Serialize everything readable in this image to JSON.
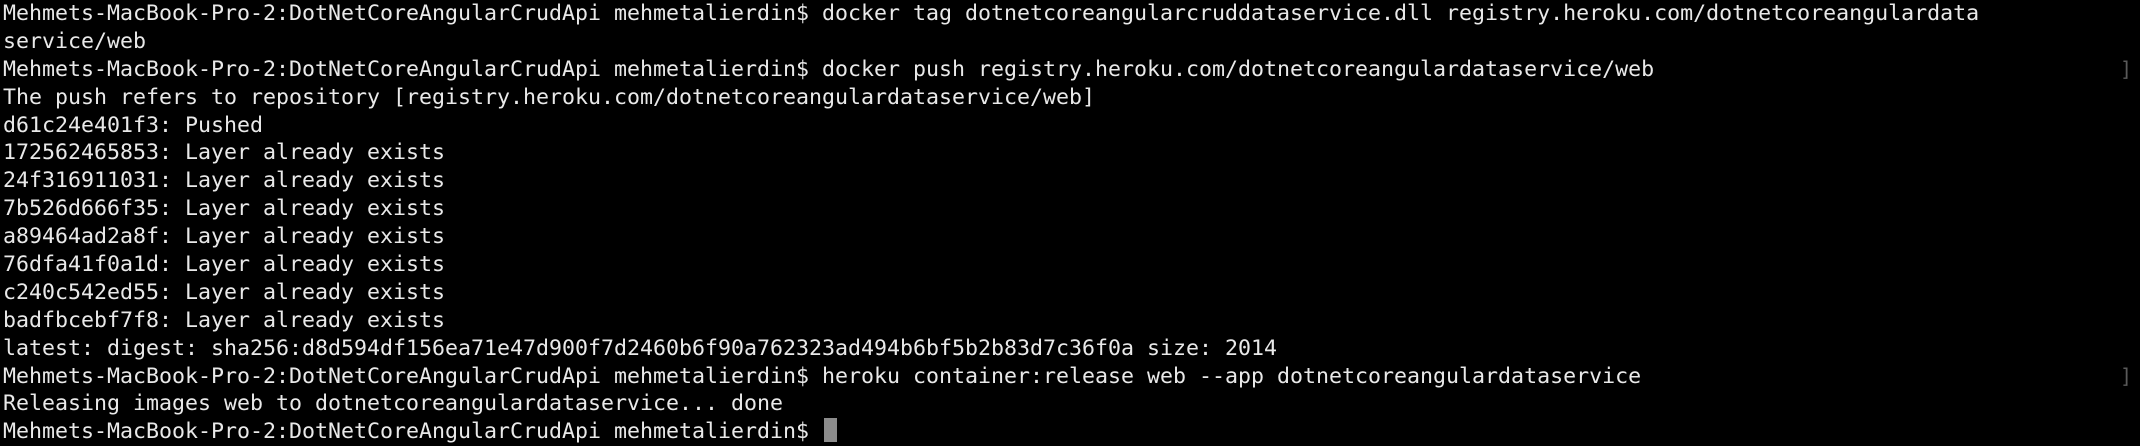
{
  "terminal": {
    "lines": [
      "Mehmets-MacBook-Pro-2:DotNetCoreAngularCrudApi mehmetalierdin$ docker tag dotnetcoreangularcruddataservice.dll registry.heroku.com/dotnetcoreangulardata",
      "service/web",
      "Mehmets-MacBook-Pro-2:DotNetCoreAngularCrudApi mehmetalierdin$ docker push registry.heroku.com/dotnetcoreangulardataservice/web",
      "The push refers to repository [registry.heroku.com/dotnetcoreangulardataservice/web]",
      "d61c24e401f3: Pushed",
      "172562465853: Layer already exists",
      "24f316911031: Layer already exists",
      "7b526d666f35: Layer already exists",
      "a89464ad2a8f: Layer already exists",
      "76dfa41f0a1d: Layer already exists",
      "c240c542ed55: Layer already exists",
      "badfbcebf7f8: Layer already exists",
      "latest: digest: sha256:d8d594df156ea71e47d900f7d2460b6f90a762323ad494b6bf5b2b83d7c36f0a size: 2014",
      "Mehmets-MacBook-Pro-2:DotNetCoreAngularCrudApi mehmetalierdin$ heroku container:release web --app dotnetcoreangulardataservice",
      "Releasing images web to dotnetcoreangulardataservice... done",
      "Mehmets-MacBook-Pro-2:DotNetCoreAngularCrudApi mehmetalierdin$ "
    ],
    "marks": {
      "row_2": "]",
      "row_13": "]"
    },
    "colors": {
      "background": "#000000",
      "text": "#e9e9e9",
      "cursor": "#8c8c8c"
    }
  }
}
